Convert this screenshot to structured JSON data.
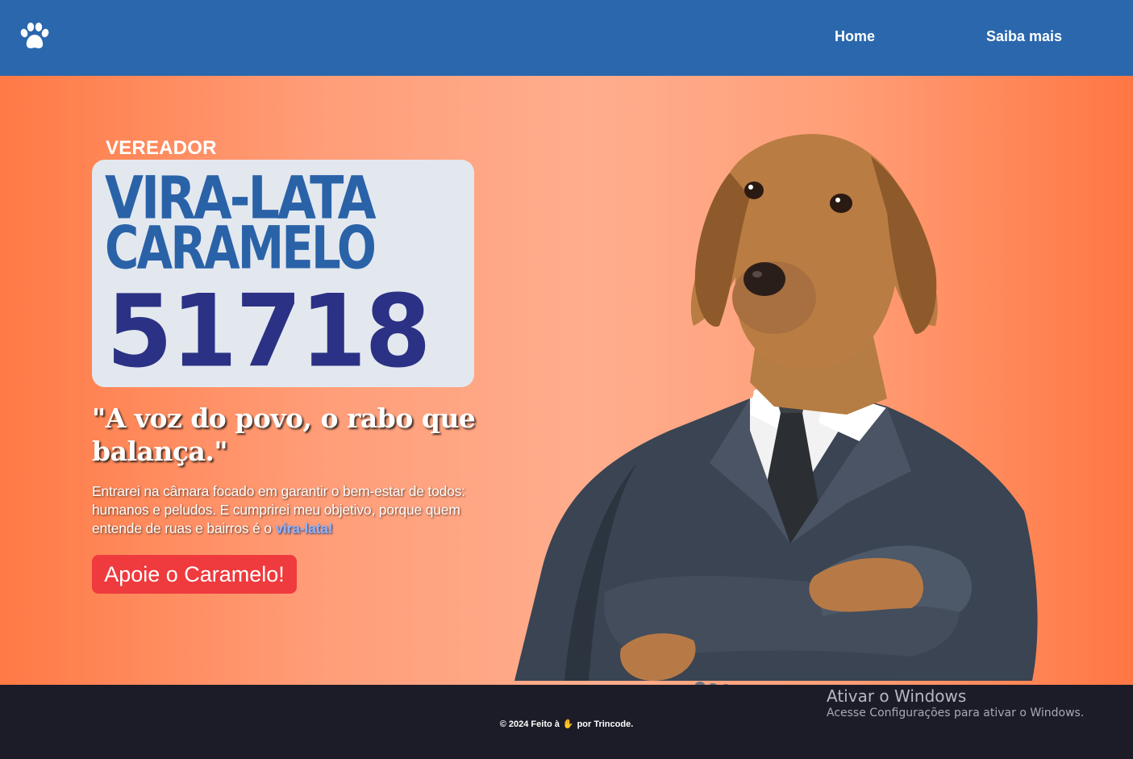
{
  "nav": {
    "logo_icon": "paw-icon",
    "links": [
      {
        "label": "Home"
      },
      {
        "label": "Saiba mais"
      }
    ],
    "background": "#2a67ad"
  },
  "hero": {
    "office": "VEREADOR",
    "candidate_name_line1": "VIRA-LATA",
    "candidate_name_line2": "CARAMELO",
    "candidate_number": "51718",
    "slogan": "\"A voz do povo, o rabo que balança.\"",
    "description_text": "Entrarei na câmara focado em garantir o bem-estar de todos: humanos e peludos. E cumprirei meu objetivo, porque quem entende de ruas e bairros é o ",
    "description_link": "vira-lata!",
    "cta_label": "Apoie o Caramelo!",
    "image_subject": "dog-in-suit-illustration",
    "colors": {
      "name": "#2a62a8",
      "number": "#2b3184",
      "cta": "#ef3a3e",
      "gradient_edge": "#ff7a45",
      "gradient_center": "#ffad8d"
    }
  },
  "footer": {
    "prefix": "© 2024 Feito à",
    "hand_icon": "waving-hand-icon",
    "suffix": "por Trincode."
  },
  "watermark": {
    "title": "Ativar o Windows",
    "subtitle": "Acesse Configurações para ativar o Windows."
  }
}
